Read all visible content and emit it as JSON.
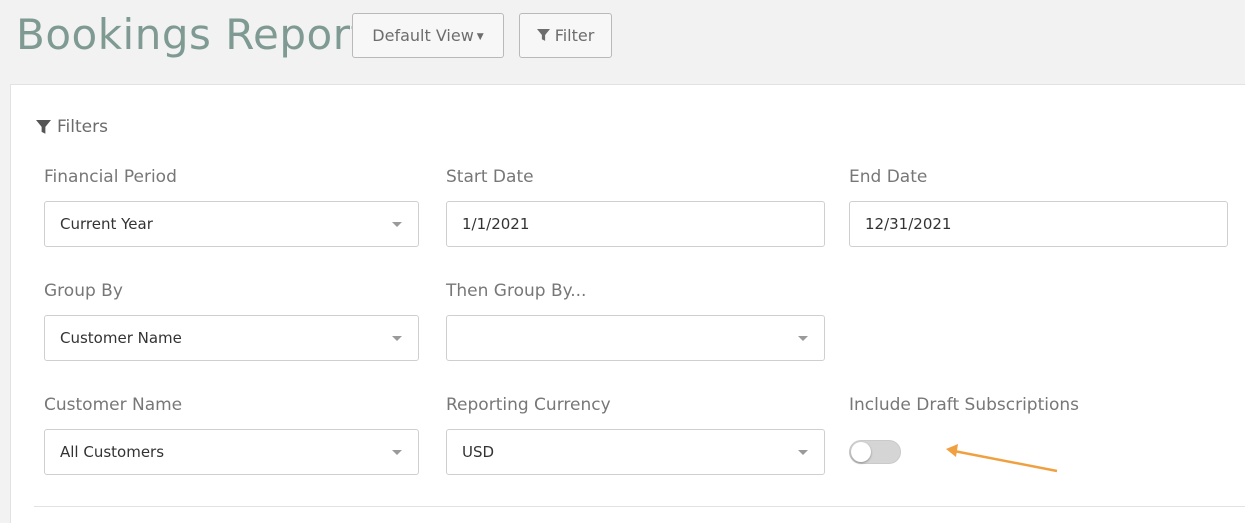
{
  "page": {
    "title": "Bookings Report",
    "view_button": "Default View",
    "filter_button": "Filter"
  },
  "filters": {
    "heading": "Filters",
    "financial_period": {
      "label": "Financial Period",
      "value": "Current Year"
    },
    "start_date": {
      "label": "Start Date",
      "value": "1/1/2021"
    },
    "end_date": {
      "label": "End Date",
      "value": "12/31/2021"
    },
    "group_by": {
      "label": "Group By",
      "value": "Customer Name"
    },
    "then_group_by": {
      "label": "Then Group By...",
      "value": ""
    },
    "customer_name": {
      "label": "Customer Name",
      "value": "All Customers"
    },
    "reporting_currency": {
      "label": "Reporting Currency",
      "value": "USD"
    },
    "include_drafts": {
      "label": "Include Draft Subscriptions",
      "enabled": false
    }
  },
  "colors": {
    "title": "#7f9a92",
    "annotation_arrow": "#f0a040"
  },
  "icons": [
    "filter-icon",
    "chevron-down-icon",
    "caret-down-icon"
  ]
}
